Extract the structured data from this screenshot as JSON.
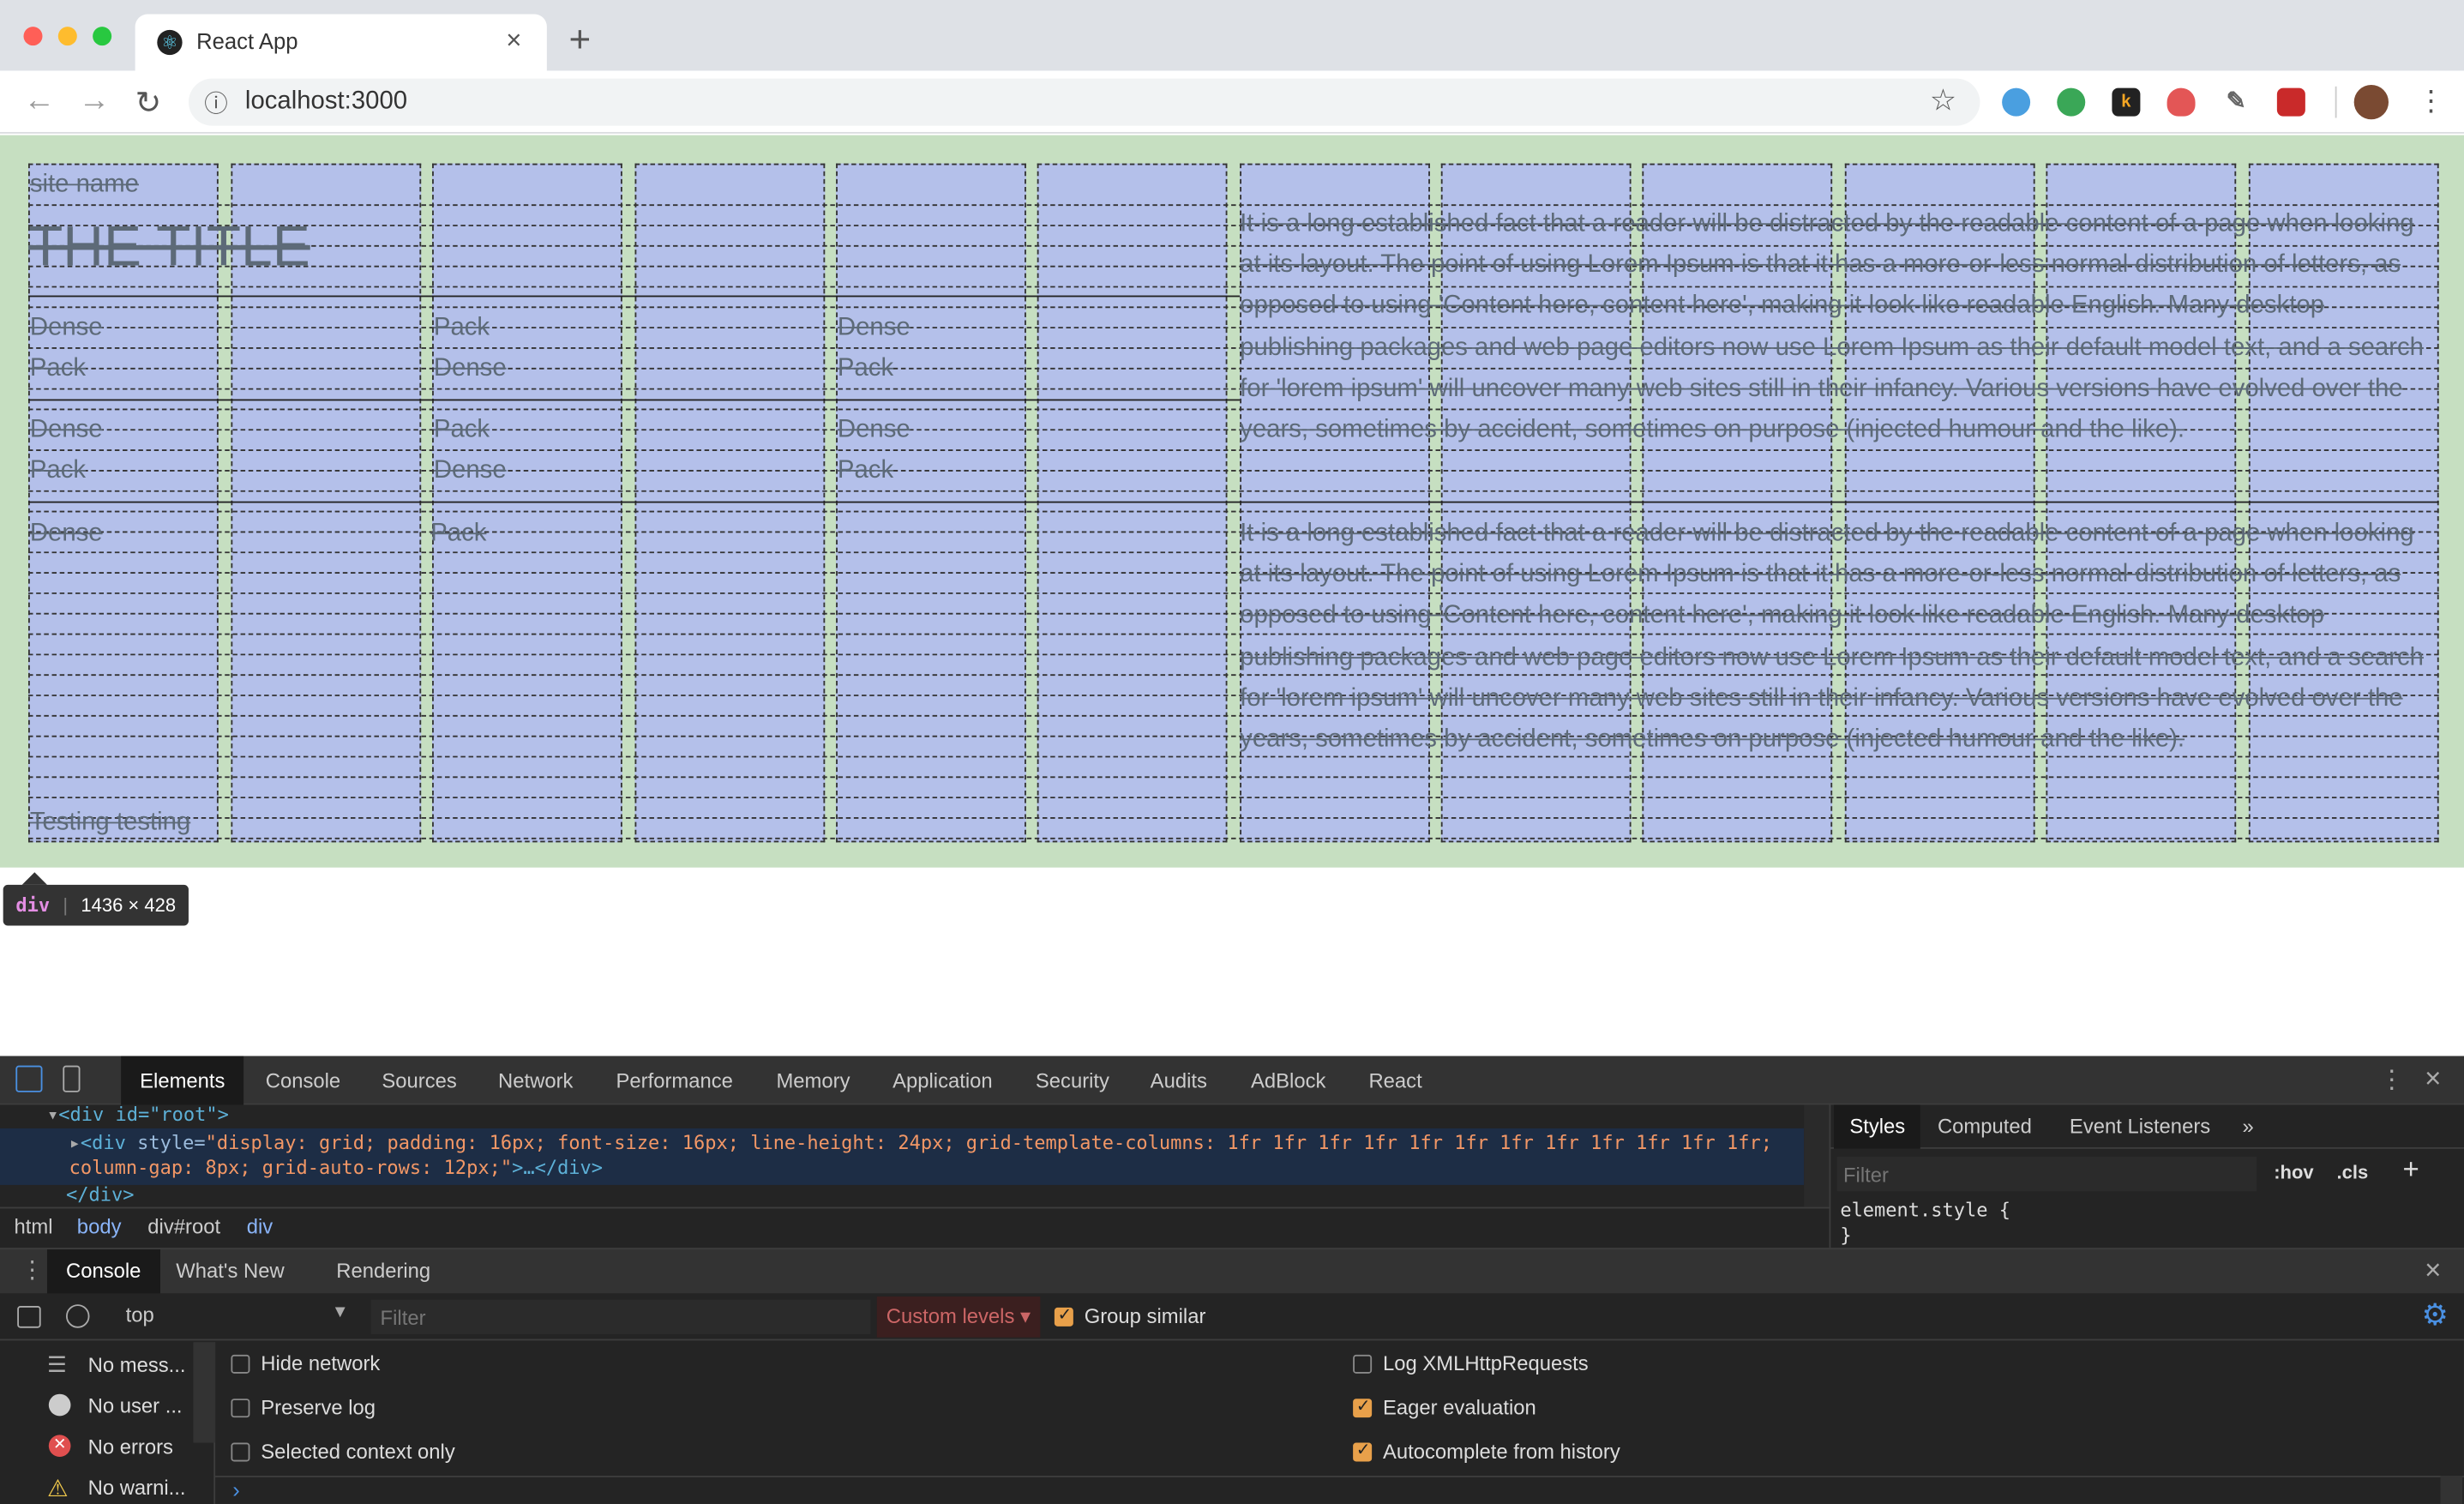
{
  "browser": {
    "tab_title": "React App",
    "tab_close": "×",
    "new_tab": "+",
    "url": "localhost:3000",
    "back": "←",
    "forward": "→",
    "reload": "↻",
    "star": "☆",
    "menu": "⋮",
    "info": "ⓘ"
  },
  "page": {
    "site_name": "site name",
    "title": "THE TITLE",
    "cells": [
      {
        "text": "Dense",
        "col": 0,
        "row": 0
      },
      {
        "text": "Pack",
        "col": 0,
        "row": 1
      },
      {
        "text": "Pack",
        "col": 2,
        "row": 0
      },
      {
        "text": "Dense",
        "col": 2,
        "row": 1
      },
      {
        "text": "Dense",
        "col": 4,
        "row": 0
      },
      {
        "text": "Pack",
        "col": 4,
        "row": 1
      }
    ],
    "cells2": [
      {
        "text": "Dense"
      },
      {
        "text": "Pack"
      },
      {
        "text": "Pack"
      },
      {
        "text": "Dense"
      },
      {
        "text": "Dense"
      },
      {
        "text": "Pack"
      }
    ],
    "cell_dense3": "Dense",
    "cell_pack3": "Pack",
    "footer": "Testing testing",
    "paragraph": "It is a long established fact that a reader will be distracted by the readable content of a page when looking at its layout. The point of using Lorem Ipsum is that it has a more-or-less normal distribution of letters, as opposed to using 'Content here, content here', making it look like readable English. Many desktop publishing packages and web page editors now use Lorem Ipsum as their default model text, and a search for 'lorem ipsum' will uncover many web sites still in their infancy. Various versions have evolved over the years, sometimes by accident, sometimes on purpose (injected humour and the like).",
    "tooltip_tag": "div",
    "tooltip_size": "1436 × 428"
  },
  "devtools": {
    "tabs": [
      "Elements",
      "Console",
      "Sources",
      "Network",
      "Performance",
      "Memory",
      "Application",
      "Security",
      "Audits",
      "AdBlock",
      "React"
    ],
    "dom": {
      "line1": "<div id=\"root\">",
      "line2_tag": "<div ",
      "line2_attr": "style=",
      "line2_val": "\"display: grid; padding: 16px; font-size: 16px; line-height: 24px; grid-template-columns: 1fr 1fr 1fr 1fr 1fr 1fr 1fr 1fr 1fr 1fr 1fr 1fr;",
      "line3_val": "column-gap: 8px; grid-auto-rows: 12px;\"",
      "line3_tail": ">…</div>",
      "line4": "</div>"
    },
    "breadcrumbs": [
      "html",
      "body",
      "div#root",
      "div"
    ],
    "styles_tabs": [
      "Styles",
      "Computed",
      "Event Listeners",
      "»"
    ],
    "filter_placeholder": "Filter",
    "hov": ":hov",
    "cls": ".cls",
    "plus": "+",
    "element_style": "element.style {",
    "close_brace": "}",
    "drawer_tabs": [
      "Console",
      "What's New",
      "Rendering"
    ],
    "context": "top",
    "console_filter": "Filter",
    "custom_levels": "Custom levels ▾",
    "group_similar": "Group similar",
    "sidebar": [
      "No mess...",
      "No user ...",
      "No errors",
      "No warni..."
    ],
    "options_left": [
      "Hide network",
      "Preserve log",
      "Selected context only"
    ],
    "options_right": [
      "Log XMLHttpRequests",
      "Eager evaluation",
      "Autocomplete from history"
    ],
    "prompt": "›",
    "colors": {
      "accent": "#e8a04a",
      "grid_bg": "#c6dfc1",
      "cell_bg": "#b4c0ea"
    }
  }
}
